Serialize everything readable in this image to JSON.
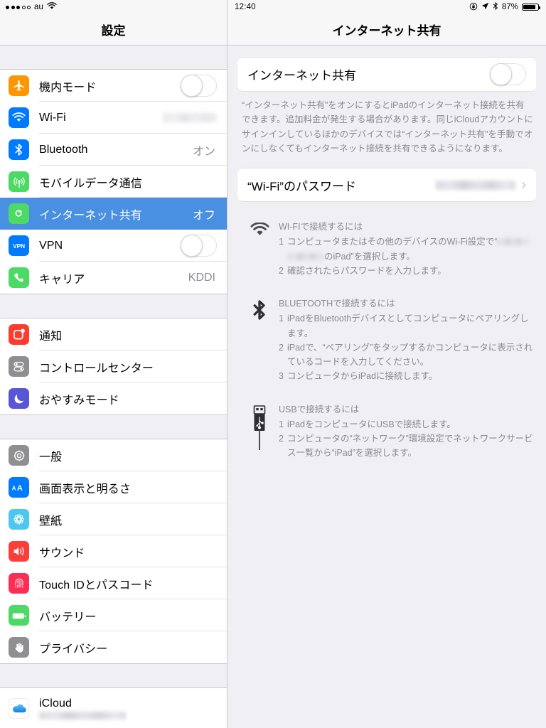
{
  "left_status": {
    "signal_filled": 3,
    "signal_empty": 2,
    "carrier": "au",
    "wifi_icon": "wifi-icon"
  },
  "left_nav": {
    "title": "設定"
  },
  "right_status": {
    "time": "12:40",
    "rotation_lock_icon": "rotation-lock-icon",
    "location_icon": "location-arrow-icon",
    "bluetooth_icon": "bluetooth-icon",
    "battery_percent": "87%",
    "battery_level": 87
  },
  "right_nav": {
    "title": "インターネット共有"
  },
  "sidebar": {
    "groups": [
      {
        "items": [
          {
            "label": "機内モード",
            "icon": "airplane-icon",
            "icon_color": "#ff9500",
            "control": "switch",
            "value": ""
          },
          {
            "label": "Wi-Fi",
            "icon": "wifi-icon",
            "icon_color": "#007aff",
            "control": "redacted",
            "value": ""
          },
          {
            "label": "Bluetooth",
            "icon": "bluetooth-icon",
            "icon_color": "#007aff",
            "control": "text",
            "value": "オン"
          },
          {
            "label": "モバイルデータ通信",
            "icon": "cellular-icon",
            "icon_color": "#4cd964",
            "control": "none",
            "value": ""
          },
          {
            "label": "インターネット共有",
            "icon": "personal-hotspot-icon",
            "icon_color": "#4cd964",
            "control": "text",
            "value": "オフ",
            "selected": true
          },
          {
            "label": "VPN",
            "icon": "vpn-icon",
            "icon_color": "#007aff",
            "control": "switch",
            "value": ""
          },
          {
            "label": "キャリア",
            "icon": "phone-icon",
            "icon_color": "#4cd964",
            "control": "text",
            "value": "KDDI"
          }
        ]
      },
      {
        "items": [
          {
            "label": "通知",
            "icon": "notifications-icon",
            "icon_color": "#ff3b30",
            "control": "none",
            "value": ""
          },
          {
            "label": "コントロールセンター",
            "icon": "control-center-icon",
            "icon_color": "#8e8e93",
            "control": "none",
            "value": ""
          },
          {
            "label": "おやすみモード",
            "icon": "do-not-disturb-icon",
            "icon_color": "#5856d6",
            "control": "none",
            "value": ""
          }
        ]
      },
      {
        "items": [
          {
            "label": "一般",
            "icon": "gear-icon",
            "icon_color": "#8e8e93",
            "control": "none",
            "value": ""
          },
          {
            "label": "画面表示と明るさ",
            "icon": "display-brightness-icon",
            "icon_color": "#007aff",
            "control": "none",
            "value": ""
          },
          {
            "label": "壁紙",
            "icon": "wallpaper-icon",
            "icon_color": "#4cc7f0",
            "control": "none",
            "value": ""
          },
          {
            "label": "サウンド",
            "icon": "sound-icon",
            "icon_color": "#fc3d39",
            "control": "none",
            "value": ""
          },
          {
            "label": "Touch IDとパスコード",
            "icon": "touch-id-icon",
            "icon_color": "#fc2e55",
            "control": "none",
            "value": ""
          },
          {
            "label": "バッテリー",
            "icon": "battery-icon",
            "icon_color": "#4cd964",
            "control": "none",
            "value": ""
          },
          {
            "label": "プライバシー",
            "icon": "privacy-hand-icon",
            "icon_color": "#8e8e93",
            "control": "none",
            "value": ""
          }
        ]
      },
      {
        "items": [
          {
            "label": "iCloud",
            "icon": "icloud-icon",
            "icon_color": "#ffffff",
            "control": "none",
            "value": "",
            "sub_redacted": true
          }
        ]
      }
    ]
  },
  "main": {
    "hotspot_row": {
      "label": "インターネット共有",
      "toggle_state": "off"
    },
    "description": "“インターネット共有”をオンにするとiPadのインターネット接続を共有できます。追加料金が発生する場合があります。同じiCloudアカウントにサインインしているほかのデバイスでは“インターネット共有”を手動でオンにしなくてもインターネット接続を共有できるようになります。",
    "password_row": {
      "label": "“Wi-Fi”のパスワード",
      "value_redacted": true,
      "chevron": "chevron-right-icon"
    },
    "instructions": [
      {
        "icon": "wifi-icon",
        "heading": "WI-FIで接続するには",
        "steps": [
          {
            "num": "1",
            "text_before": "コンピュータまたはその他のデバイスのWi-Fi設定で“",
            "redacted": true,
            "text_after": "のiPad”を選択します。"
          },
          {
            "num": "2",
            "text_before": "確認されたらパスワードを入力します。",
            "redacted": false,
            "text_after": ""
          }
        ]
      },
      {
        "icon": "bluetooth-icon",
        "heading": "BLUETOOTHで接続するには",
        "steps": [
          {
            "num": "1",
            "text_before": "iPadをBluetoothデバイスとしてコンピュータにペアリングします。",
            "redacted": false,
            "text_after": ""
          },
          {
            "num": "2",
            "text_before": "iPadで、“ペアリング”をタップするかコンピュータに表示されているコードを入力してください。",
            "redacted": false,
            "text_after": ""
          },
          {
            "num": "3",
            "text_before": "コンピュータからiPadに接続します。",
            "redacted": false,
            "text_after": ""
          }
        ]
      },
      {
        "icon": "usb-cable-icon",
        "heading": "USBで接続するには",
        "steps": [
          {
            "num": "1",
            "text_before": "iPadをコンピュータにUSBで接続します。",
            "redacted": false,
            "text_after": ""
          },
          {
            "num": "2",
            "text_before": "コンピュータの“ネットワーク”環境設定でネットワークサービス一覧から“iPad”を選択します。",
            "redacted": false,
            "text_after": ""
          }
        ]
      }
    ]
  },
  "colors": {
    "selected_row": "#4a90e2",
    "group_background": "#efeff4",
    "separator": "#c8c7cc",
    "secondary_text": "#8e8e93"
  }
}
